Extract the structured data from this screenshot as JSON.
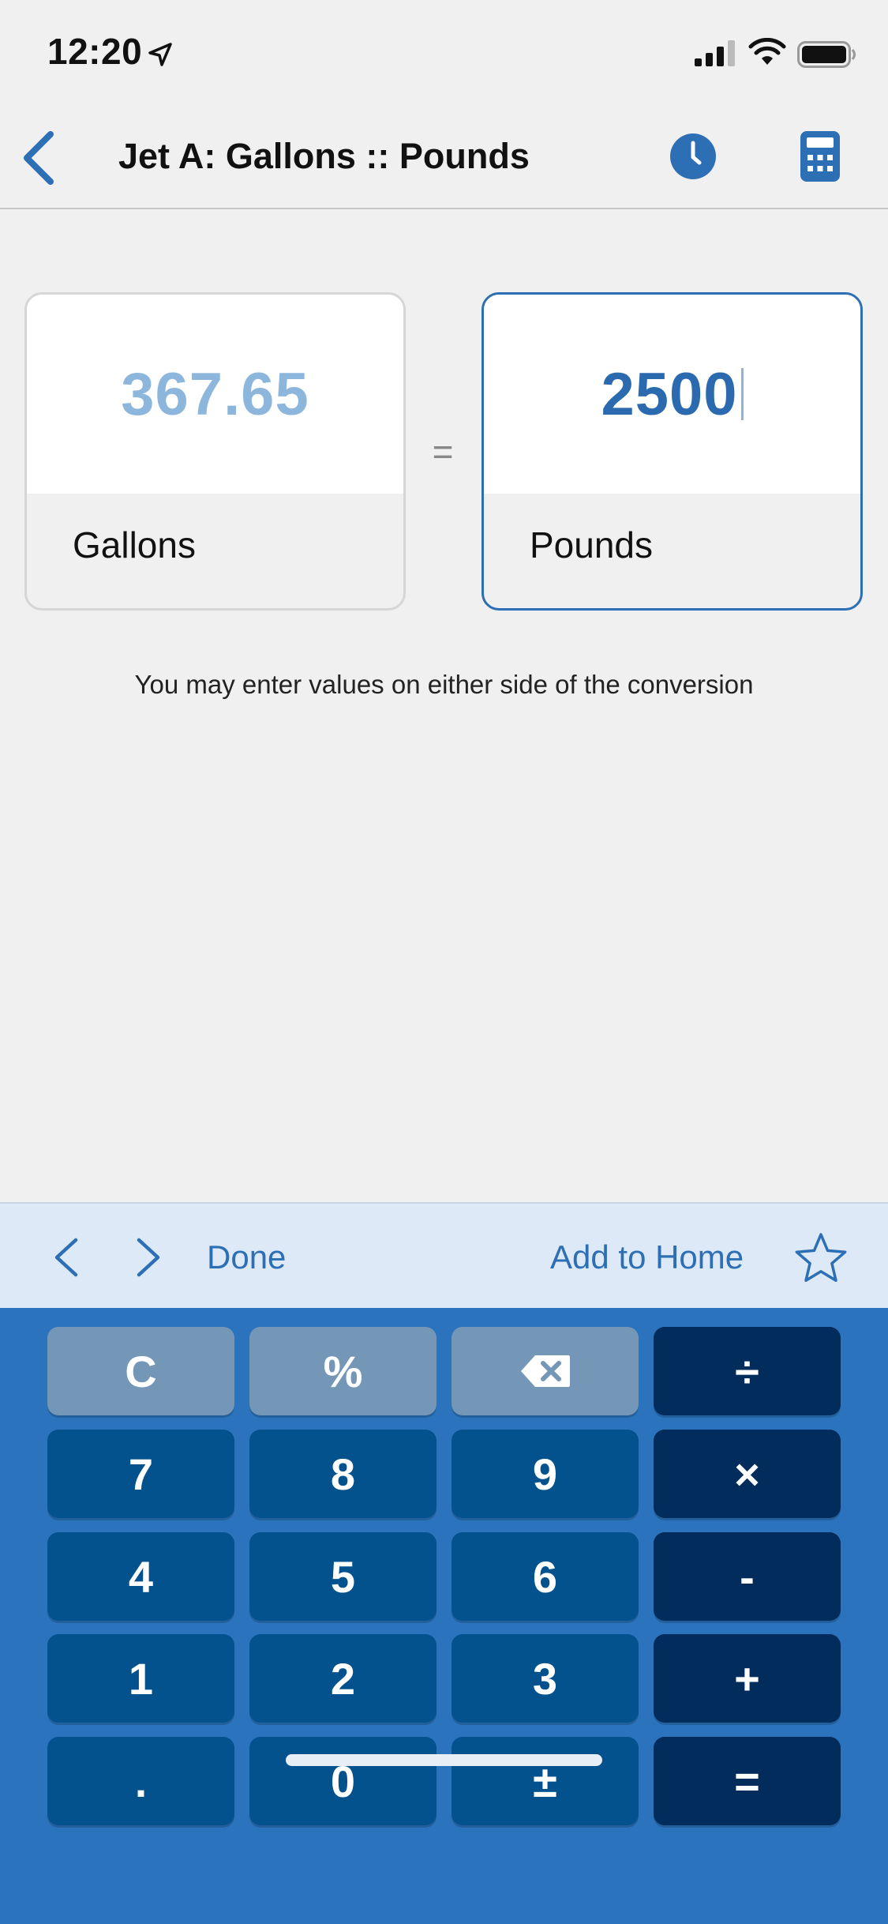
{
  "status_bar": {
    "time": "12:20"
  },
  "nav": {
    "title": "Jet A: Gallons :: Pounds"
  },
  "conversion": {
    "left": {
      "value": "367.65",
      "unit": "Gallons"
    },
    "right": {
      "value": "2500",
      "unit": "Pounds"
    },
    "equals": "=",
    "hint": "You may enter values on either side of the conversion"
  },
  "toolbar": {
    "done_label": "Done",
    "add_home_label": "Add to Home"
  },
  "keypad": {
    "rows": [
      [
        "C",
        "%",
        "⌫",
        "÷"
      ],
      [
        "7",
        "8",
        "9",
        "×"
      ],
      [
        "4",
        "5",
        "6",
        "-"
      ],
      [
        "1",
        "2",
        "3",
        "+"
      ],
      [
        ".",
        "0",
        "±",
        "="
      ]
    ]
  },
  "colors": {
    "accent": "#2d6fb4",
    "keypad_background": "#2b74bd",
    "key_function": "#7497b7",
    "key_number": "#03528e",
    "key_operator": "#012c5c",
    "converted_value": "#8db6dc"
  },
  "icons": {
    "back": "chevron-left-icon",
    "history": "clock-icon",
    "calculator": "calculator-icon",
    "prev": "chevron-left-icon",
    "next": "chevron-right-icon",
    "favorite": "star-icon",
    "backspace": "backspace-icon"
  }
}
